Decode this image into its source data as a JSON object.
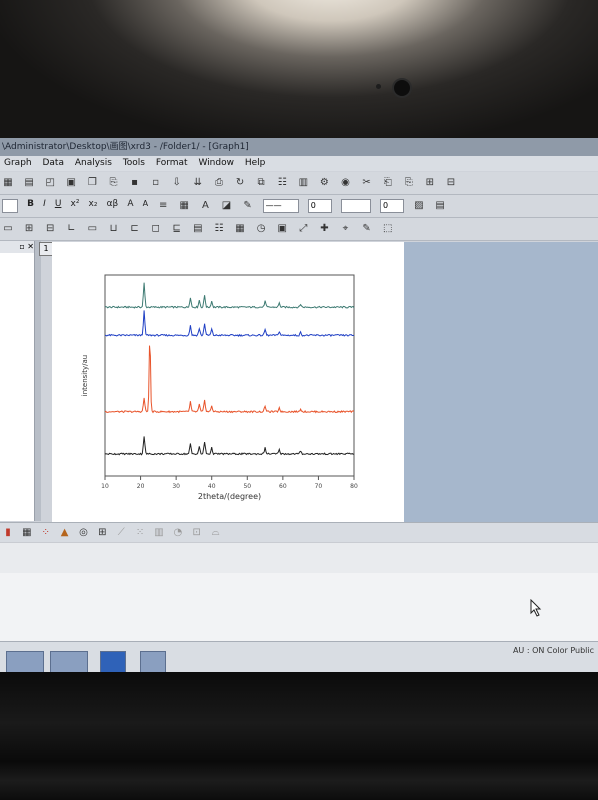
{
  "window": {
    "title": "\\Administrator\\Desktop\\画图\\xrd3 - /Folder1/ - [Graph1]"
  },
  "menu": {
    "items": [
      "Graph",
      "Data",
      "Analysis",
      "Tools",
      "Format",
      "Window",
      "Help"
    ]
  },
  "format_toolbar": {
    "bold": "B",
    "italic": "I",
    "underline": "U",
    "superscript": "x²",
    "subscript": "x₂",
    "greek": "αβ",
    "font_up": "A",
    "font_down": "A",
    "line_width_1": "0",
    "line_width_2": "0"
  },
  "graph": {
    "layer_label": "1",
    "colors": {
      "series_1": "#3d7a72",
      "series_2": "#1f3fc4",
      "series_3": "#e8532a",
      "series_4": "#222222"
    },
    "chart_data": {
      "type": "line",
      "xlabel": "2theta/(degree)",
      "ylabel": "intensity/au",
      "xlim": [
        10,
        80
      ],
      "x_ticks": [
        "10",
        "20",
        "30",
        "40",
        "50",
        "60",
        "70",
        "80"
      ],
      "grid": false,
      "series": [
        {
          "color": "#3d7a72",
          "baseline": 0.84,
          "peaks": [
            [
              21.0,
              0.12
            ],
            [
              34.0,
              0.05
            ],
            [
              36.5,
              0.035
            ],
            [
              38.0,
              0.06
            ],
            [
              40.0,
              0.03
            ],
            [
              55.0,
              0.03
            ],
            [
              59.0,
              0.02
            ],
            [
              65.0,
              0.015
            ]
          ]
        },
        {
          "color": "#1f3fc4",
          "baseline": 0.7,
          "peaks": [
            [
              21.0,
              0.12
            ],
            [
              34.0,
              0.05
            ],
            [
              36.5,
              0.035
            ],
            [
              38.0,
              0.06
            ],
            [
              40.0,
              0.03
            ],
            [
              55.0,
              0.03
            ],
            [
              59.0,
              0.02
            ],
            [
              65.0,
              0.015
            ]
          ]
        },
        {
          "color": "#e8532a",
          "baseline": 0.32,
          "peaks": [
            [
              21.0,
              0.07
            ],
            [
              22.6,
              0.37
            ],
            [
              34.0,
              0.05
            ],
            [
              36.5,
              0.035
            ],
            [
              38.0,
              0.06
            ],
            [
              40.0,
              0.03
            ],
            [
              55.0,
              0.03
            ],
            [
              59.0,
              0.02
            ],
            [
              65.0,
              0.015
            ]
          ]
        },
        {
          "color": "#222222",
          "baseline": 0.11,
          "peaks": [
            [
              21.0,
              0.09
            ],
            [
              34.0,
              0.05
            ],
            [
              36.5,
              0.035
            ],
            [
              38.0,
              0.06
            ],
            [
              40.0,
              0.03
            ],
            [
              55.0,
              0.03
            ],
            [
              59.0,
              0.02
            ],
            [
              65.0,
              0.015
            ]
          ]
        }
      ]
    }
  },
  "status": {
    "text": "AU : ON   Color Public"
  },
  "taskbar": {
    "apps": [
      "app-1",
      "app-2",
      "word",
      "origin"
    ]
  }
}
